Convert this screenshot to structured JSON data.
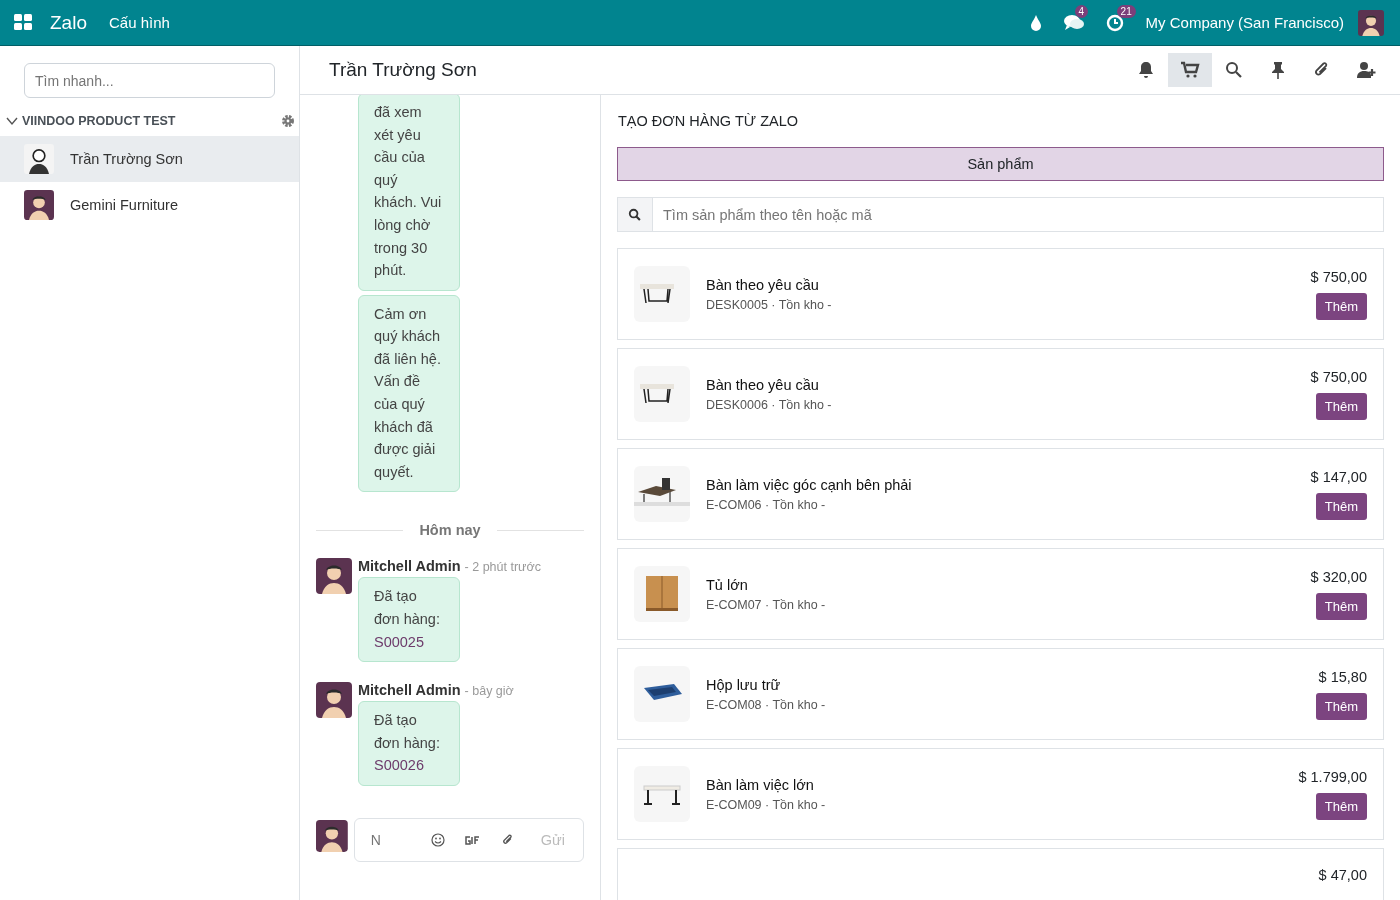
{
  "topbar": {
    "app_name": "Zalo",
    "menu": [
      "Cấu hình"
    ],
    "chat_badge": "4",
    "activity_badge": "21",
    "company": "My Company (San Francisco)"
  },
  "sidebar": {
    "search_placeholder": "Tìm nhanh...",
    "group": {
      "label": "VIINDOO PRODUCT TEST",
      "expanded": true
    },
    "contacts": [
      {
        "name": "Trần Trường Sơn",
        "selected": true
      },
      {
        "name": "Gemini Furniture",
        "selected": false
      }
    ]
  },
  "chat": {
    "title": "Trần Trường Sơn",
    "toolbar": [
      {
        "kind": "bell",
        "selected": false
      },
      {
        "kind": "cart",
        "selected": true
      },
      {
        "kind": "search",
        "selected": false
      },
      {
        "kind": "pin",
        "selected": false
      },
      {
        "kind": "paperclip",
        "selected": false
      },
      {
        "kind": "add-user",
        "selected": false
      }
    ],
    "messages": [
      {
        "kind": "bubble",
        "text": "đã xem xét yêu cầu của quý khách. Vui lòng chờ trong 30 phút."
      },
      {
        "kind": "bubble",
        "text": "Cảm ơn quý khách đã liên hệ. Vấn đề của quý khách đã được giải quyết."
      },
      {
        "kind": "separator",
        "text": "Hôm nay"
      },
      {
        "kind": "post",
        "author": "Mitchell Admin",
        "time": "- 2 phút trước",
        "text": "Đã tạo đơn hàng:",
        "link": "S00025"
      },
      {
        "kind": "post",
        "author": "Mitchell Admin",
        "time": "- bây giờ",
        "text": "Đã tạo đơn hàng:",
        "link": "S00026"
      }
    ],
    "composer": {
      "placeholder": "N",
      "send": "Gửi"
    }
  },
  "order": {
    "title": "TẠO ĐƠN HÀNG TỪ ZALO",
    "tab": "Sản phẩm",
    "search_placeholder": "Tìm sản phẩm theo tên hoặc mã",
    "products": [
      {
        "name": "Bàn theo yêu cầu",
        "details": "DESK0005 · Tồn kho -",
        "price": "$ 750,00",
        "button": "Thêm"
      },
      {
        "name": "Bàn theo yêu cầu",
        "details": "DESK0006 · Tồn kho -",
        "price": "$ 750,00",
        "button": "Thêm"
      },
      {
        "name": "Bàn làm việc góc cạnh bên phải",
        "details": "E-COM06 · Tồn kho -",
        "price": "$ 147,00",
        "button": "Thêm"
      },
      {
        "name": "Tủ lớn",
        "details": "E-COM07 · Tồn kho -",
        "price": "$ 320,00",
        "button": "Thêm"
      },
      {
        "name": "Hộp lưu trữ",
        "details": "E-COM08 · Tồn kho -",
        "price": "$ 15,80",
        "button": "Thêm"
      },
      {
        "name": "Bàn làm việc lớn",
        "details": "E-COM09 · Tồn kho -",
        "price": "$ 1.799,00",
        "button": "Thêm"
      },
      {
        "price": "$ 47,00"
      }
    ]
  }
}
